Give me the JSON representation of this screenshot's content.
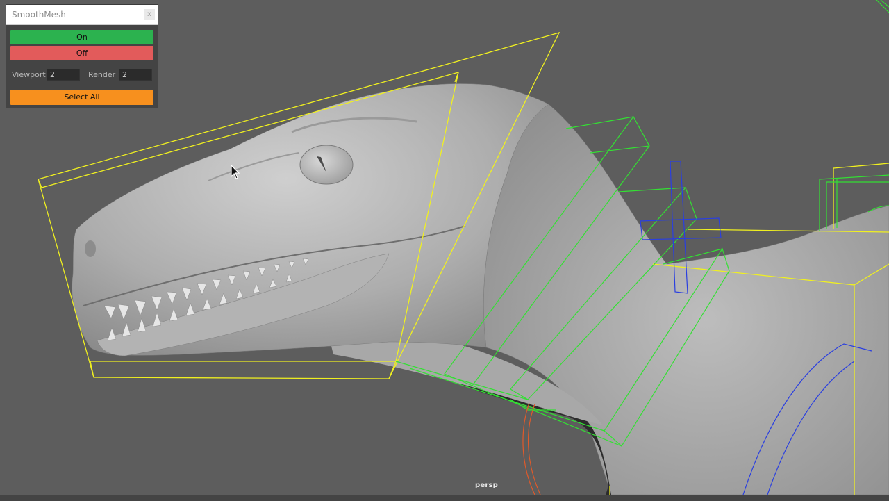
{
  "panel": {
    "title": "SmoothMesh",
    "close_label": "x",
    "on_label": "On",
    "off_label": "Off",
    "viewport_label": "Viewport",
    "viewport_value": "2",
    "render_label": "Render",
    "render_value": "2",
    "select_all_label": "Select All"
  },
  "viewport": {
    "camera": "persp"
  },
  "colors": {
    "background": "#5d5d5d",
    "on": "#2cb24f",
    "off": "#e25b5b",
    "select_all": "#f7901e",
    "selection": "#f0f020",
    "controller": "#33e033",
    "joint": "#2a3fe0"
  }
}
